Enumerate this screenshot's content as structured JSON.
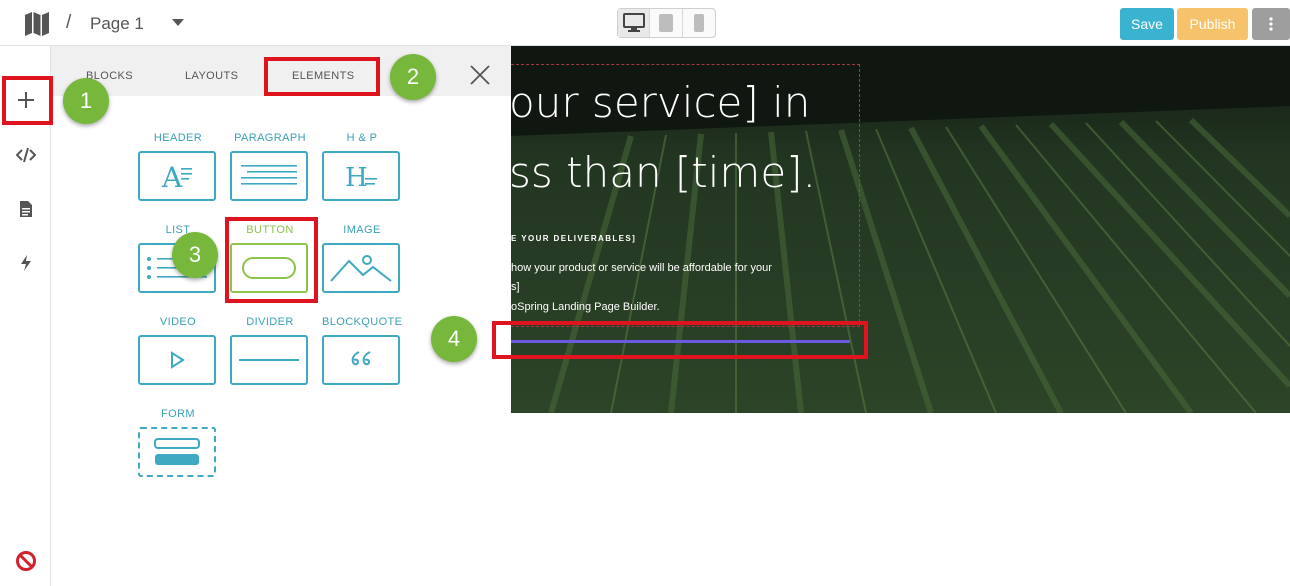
{
  "topbar": {
    "page_sep": "/",
    "page_name": "Page 1",
    "save_label": "Save",
    "publish_label": "Publish",
    "devices": [
      "desktop-icon",
      "tablet-icon",
      "mobile-icon"
    ]
  },
  "panel": {
    "tabs": [
      "BLOCKS",
      "LAYOUTS",
      "ELEMENTS"
    ],
    "elements": [
      {
        "label": "HEADER"
      },
      {
        "label": "PARAGRAPH"
      },
      {
        "label": "H & P"
      },
      {
        "label": "LIST"
      },
      {
        "label": "BUTTON"
      },
      {
        "label": "IMAGE"
      },
      {
        "label": "VIDEO"
      },
      {
        "label": "DIVIDER"
      },
      {
        "label": "BLOCKQUOTE"
      },
      {
        "label": "FORM"
      }
    ]
  },
  "hero": {
    "line1": "our service] in",
    "line2": "ss than [time].",
    "subheading": "E YOUR DELIVERABLES]",
    "p1": "how your product or service will be affordable for your",
    "p2": "s]",
    "p3": "oSpring Landing Page Builder."
  },
  "annotations": [
    "1",
    "2",
    "3",
    "4"
  ],
  "colors": {
    "accent": "#3ea9c0",
    "selected": "#8cc34a",
    "save": "#3ab3d0",
    "publish": "#f6c26a",
    "annotation": "#e0141e",
    "badge": "#77b73b"
  }
}
